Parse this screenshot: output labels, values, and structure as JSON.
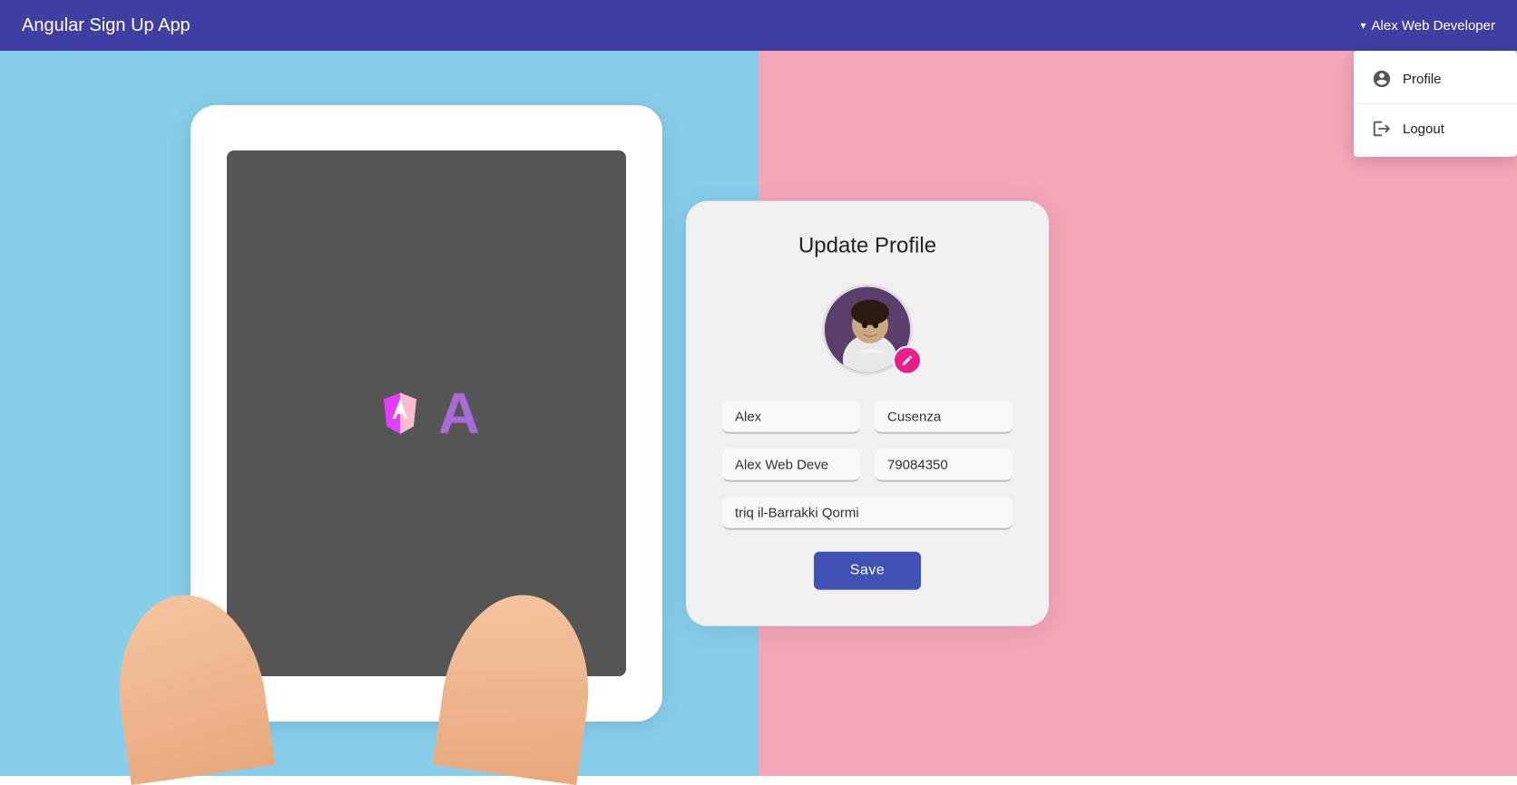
{
  "app": {
    "title": "Angular Sign Up App"
  },
  "navbar": {
    "user_name": "Alex Web Developer",
    "chevron": "▾"
  },
  "dropdown": {
    "profile_label": "Profile",
    "logout_label": "Logout"
  },
  "card": {
    "title": "Update Profile",
    "first_name": "Alex",
    "last_name": "Cusenza",
    "username": "Alex Web Deve",
    "phone": "79084350",
    "address": "triq il-Barrakki Qormi",
    "save_label": "Save"
  },
  "colors": {
    "navbar_bg": "#3f3fa3",
    "bg_left": "#87ceeb",
    "bg_right": "#f4a7b9",
    "save_btn": "#3f51b5",
    "edit_btn": "#e91e8c"
  }
}
